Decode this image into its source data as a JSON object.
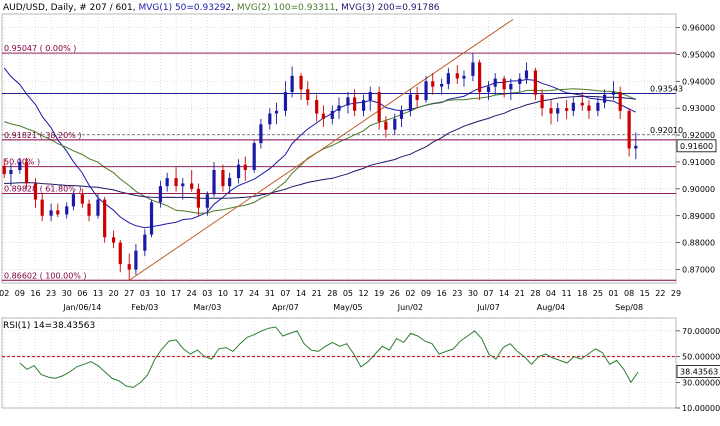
{
  "header": {
    "symbol": "AUD/USD",
    "timeframe": "Daily",
    "bar_info": "# 207 / 601",
    "ma1": "MVG(1) 50=0.93292",
    "ma2": "MVG(2) 100=0.93311",
    "ma3": "MVG(3) 200=0.91786"
  },
  "colors": {
    "up": "#1a1aa6",
    "down": "#cc0000",
    "ma50": "#1a1aa6",
    "ma100": "#4a7a2a",
    "ma200": "#1a1a6a",
    "fib": "#800040",
    "trend": "#c0602a",
    "rsi": "#2e7d32",
    "rsi_level": "#cc0000"
  },
  "chart_data": [
    {
      "type": "candlestick",
      "ylim": [
        0.865,
        0.965
      ],
      "yticks": [
        "0.96000",
        "0.95000",
        "0.94000",
        "0.93000",
        "0.92000",
        "0.91000",
        "0.90000",
        "0.89000",
        "0.88000",
        "0.87000"
      ],
      "xticks": [
        "02",
        "09",
        "16",
        "23",
        "30",
        "06",
        "13",
        "20",
        "27",
        "03",
        "10",
        "17",
        "24",
        "03",
        "10",
        "17",
        "24",
        "31",
        "07",
        "14",
        "21",
        "28",
        "05",
        "12",
        "19",
        "26",
        "02",
        "09",
        "16",
        "23",
        "30",
        "07",
        "14",
        "21",
        "28",
        "04",
        "11",
        "18",
        "25",
        "01",
        "08",
        "15",
        "22",
        "29"
      ],
      "month_labels": [
        "Jan/06/14",
        "Feb/03",
        "Mar/03",
        "Apr/07",
        "May/05",
        "Jun/02",
        "Jul/07",
        "Aug/04",
        "Sep/08"
      ],
      "fib_levels": [
        {
          "label": "0.95047 ( 0.00% )",
          "value": 0.95047
        },
        {
          "label": "0.91821 ( 38.20% )",
          "value": 0.91821
        },
        {
          "label": "50.00% )",
          "value": 0.90825
        },
        {
          "label": "0.89828 ( 61.80% )",
          "value": 0.89828
        },
        {
          "label": "0.86602 ( 100.00% )",
          "value": 0.86602
        }
      ],
      "horizontal_lines": [
        {
          "label": "0.93543",
          "value": 0.93543
        },
        {
          "label": "0.92010",
          "value": 0.9201
        }
      ],
      "current_price": "0.91600",
      "trendline": {
        "start": [
          "2014-01-27",
          0.866
        ],
        "end": [
          "2014-07-18",
          0.963
        ]
      },
      "ohlc": [
        [
          "2013-12-02",
          0.9085,
          0.9112,
          0.904,
          0.9055
        ],
        [
          "2013-12-05",
          0.9055,
          0.909,
          0.901,
          0.907
        ],
        [
          "2013-12-09",
          0.907,
          0.9115,
          0.9055,
          0.91
        ],
        [
          "2013-12-12",
          0.91,
          0.9115,
          0.9,
          0.902
        ],
        [
          "2013-12-16",
          0.902,
          0.904,
          0.893,
          0.896
        ],
        [
          "2013-12-19",
          0.896,
          0.8985,
          0.888,
          0.89
        ],
        [
          "2013-12-23",
          0.89,
          0.8945,
          0.888,
          0.892
        ],
        [
          "2013-12-26",
          0.892,
          0.8945,
          0.8895,
          0.8905
        ],
        [
          "2013-12-30",
          0.8905,
          0.895,
          0.889,
          0.8935
        ],
        [
          "2014-01-02",
          0.8935,
          0.899,
          0.892,
          0.898
        ],
        [
          "2014-01-06",
          0.898,
          0.9,
          0.893,
          0.8945
        ],
        [
          "2014-01-09",
          0.8945,
          0.896,
          0.888,
          0.89
        ],
        [
          "2014-01-13",
          0.89,
          0.898,
          0.889,
          0.896
        ],
        [
          "2014-01-16",
          0.896,
          0.897,
          0.88,
          0.882
        ],
        [
          "2014-01-20",
          0.882,
          0.8845,
          0.878,
          0.88
        ],
        [
          "2014-01-23",
          0.88,
          0.881,
          0.869,
          0.872
        ],
        [
          "2014-01-27",
          0.872,
          0.876,
          0.866,
          0.87
        ],
        [
          "2014-01-30",
          0.87,
          0.8795,
          0.868,
          0.877
        ],
        [
          "2014-02-03",
          0.877,
          0.885,
          0.875,
          0.883
        ],
        [
          "2014-02-06",
          0.883,
          0.896,
          0.882,
          0.895
        ],
        [
          "2014-02-10",
          0.895,
          0.903,
          0.893,
          0.901
        ],
        [
          "2014-02-13",
          0.901,
          0.906,
          0.899,
          0.904
        ],
        [
          "2014-02-17",
          0.904,
          0.908,
          0.899,
          0.901
        ],
        [
          "2014-02-20",
          0.901,
          0.904,
          0.896,
          0.902
        ],
        [
          "2014-02-24",
          0.902,
          0.907,
          0.899,
          0.9
        ],
        [
          "2014-02-27",
          0.9,
          0.902,
          0.89,
          0.893
        ],
        [
          "2014-03-03",
          0.893,
          0.899,
          0.89,
          0.898
        ],
        [
          "2014-03-06",
          0.898,
          0.91,
          0.897,
          0.907
        ],
        [
          "2014-03-10",
          0.907,
          0.909,
          0.899,
          0.901
        ],
        [
          "2014-03-13",
          0.901,
          0.906,
          0.898,
          0.904
        ],
        [
          "2014-03-17",
          0.904,
          0.911,
          0.902,
          0.909
        ],
        [
          "2014-03-20",
          0.909,
          0.912,
          0.903,
          0.907
        ],
        [
          "2014-03-24",
          0.907,
          0.918,
          0.906,
          0.917
        ],
        [
          "2014-03-27",
          0.917,
          0.926,
          0.915,
          0.924
        ],
        [
          "2014-03-31",
          0.924,
          0.93,
          0.922,
          0.928
        ],
        [
          "2014-04-03",
          0.928,
          0.932,
          0.924,
          0.929
        ],
        [
          "2014-04-07",
          0.929,
          0.94,
          0.927,
          0.936
        ],
        [
          "2014-04-10",
          0.936,
          0.9455,
          0.934,
          0.942
        ],
        [
          "2014-04-14",
          0.942,
          0.943,
          0.933,
          0.937
        ],
        [
          "2014-04-17",
          0.937,
          0.94,
          0.931,
          0.933
        ],
        [
          "2014-04-21",
          0.933,
          0.935,
          0.925,
          0.928
        ],
        [
          "2014-04-24",
          0.928,
          0.931,
          0.923,
          0.926
        ],
        [
          "2014-04-28",
          0.926,
          0.931,
          0.924,
          0.929
        ],
        [
          "2014-05-01",
          0.929,
          0.934,
          0.926,
          0.931
        ],
        [
          "2014-05-05",
          0.931,
          0.936,
          0.928,
          0.934
        ],
        [
          "2014-05-08",
          0.934,
          0.937,
          0.927,
          0.929
        ],
        [
          "2014-05-12",
          0.929,
          0.935,
          0.927,
          0.933
        ],
        [
          "2014-05-15",
          0.933,
          0.938,
          0.929,
          0.936
        ],
        [
          "2014-05-19",
          0.936,
          0.938,
          0.922,
          0.925
        ],
        [
          "2014-05-22",
          0.925,
          0.927,
          0.919,
          0.922
        ],
        [
          "2014-05-26",
          0.922,
          0.928,
          0.92,
          0.926
        ],
        [
          "2014-05-29",
          0.926,
          0.931,
          0.923,
          0.929
        ],
        [
          "2014-06-02",
          0.929,
          0.937,
          0.927,
          0.935
        ],
        [
          "2014-06-05",
          0.935,
          0.938,
          0.93,
          0.933
        ],
        [
          "2014-06-09",
          0.933,
          0.942,
          0.932,
          0.94
        ],
        [
          "2014-06-12",
          0.94,
          0.943,
          0.935,
          0.938
        ],
        [
          "2014-06-16",
          0.938,
          0.941,
          0.935,
          0.939
        ],
        [
          "2014-06-19",
          0.939,
          0.945,
          0.937,
          0.943
        ],
        [
          "2014-06-23",
          0.943,
          0.946,
          0.939,
          0.941
        ],
        [
          "2014-06-26",
          0.941,
          0.944,
          0.938,
          0.942
        ],
        [
          "2014-06-30",
          0.942,
          0.9505,
          0.94,
          0.947
        ],
        [
          "2014-07-03",
          0.947,
          0.948,
          0.933,
          0.936
        ],
        [
          "2014-07-07",
          0.936,
          0.94,
          0.933,
          0.938
        ],
        [
          "2014-07-10",
          0.938,
          0.943,
          0.935,
          0.941
        ],
        [
          "2014-07-14",
          0.941,
          0.942,
          0.934,
          0.937
        ],
        [
          "2014-07-17",
          0.937,
          0.941,
          0.933,
          0.939
        ],
        [
          "2014-07-21",
          0.939,
          0.943,
          0.936,
          0.941
        ],
        [
          "2014-07-24",
          0.941,
          0.947,
          0.939,
          0.944
        ],
        [
          "2014-07-28",
          0.944,
          0.945,
          0.933,
          0.935
        ],
        [
          "2014-07-31",
          0.935,
          0.937,
          0.927,
          0.93
        ],
        [
          "2014-08-04",
          0.93,
          0.933,
          0.924,
          0.928
        ],
        [
          "2014-08-07",
          0.928,
          0.932,
          0.925,
          0.93
        ],
        [
          "2014-08-11",
          0.93,
          0.933,
          0.926,
          0.929
        ],
        [
          "2014-08-14",
          0.929,
          0.934,
          0.927,
          0.932
        ],
        [
          "2014-08-18",
          0.932,
          0.936,
          0.929,
          0.931
        ],
        [
          "2014-08-21",
          0.931,
          0.933,
          0.926,
          0.929
        ],
        [
          "2014-08-25",
          0.929,
          0.934,
          0.927,
          0.932
        ],
        [
          "2014-08-28",
          0.932,
          0.937,
          0.93,
          0.935
        ],
        [
          "2014-09-01",
          0.935,
          0.94,
          0.933,
          0.936
        ],
        [
          "2014-09-04",
          0.936,
          0.938,
          0.926,
          0.929
        ],
        [
          "2014-09-08",
          0.929,
          0.93,
          0.912,
          0.915
        ],
        [
          "2014-09-11",
          0.915,
          0.921,
          0.911,
          0.916
        ]
      ]
    },
    {
      "type": "line",
      "title": "RSI(1) 14=38.43563",
      "ylim": [
        10,
        80
      ],
      "yticks": [
        "70.00000",
        "50.00000",
        "30.00000",
        "10.00000"
      ],
      "reference_level": 50,
      "current_value": "38.43563",
      "values": [
        45,
        40,
        43,
        36,
        34,
        33,
        35,
        38,
        42,
        44,
        46,
        43,
        38,
        33,
        31,
        27,
        26,
        30,
        36,
        48,
        56,
        62,
        63,
        56,
        52,
        55,
        50,
        48,
        56,
        57,
        54,
        60,
        65,
        67,
        70,
        72,
        73,
        66,
        68,
        70,
        60,
        55,
        54,
        58,
        61,
        58,
        60,
        52,
        42,
        46,
        52,
        58,
        55,
        64,
        61,
        68,
        66,
        62,
        60,
        52,
        54,
        56,
        62,
        66,
        70,
        64,
        52,
        48,
        57,
        60,
        54,
        50,
        44,
        50,
        52,
        49,
        47,
        45,
        50,
        48,
        52,
        56,
        53,
        44,
        47,
        40,
        30,
        38
      ]
    }
  ]
}
